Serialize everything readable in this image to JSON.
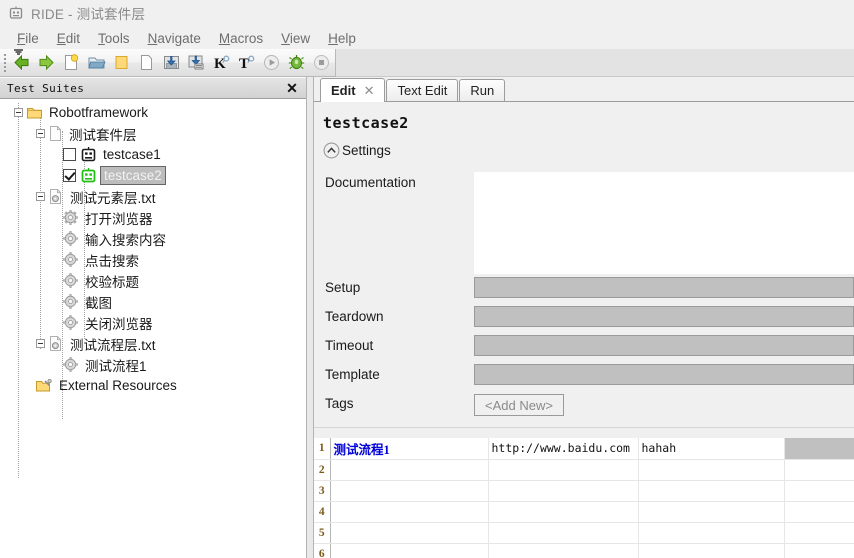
{
  "window": {
    "title": "RIDE - 测试套件层",
    "icon": "robot-icon"
  },
  "menubar": {
    "items": [
      {
        "mnemonic": "F",
        "rest": "ile"
      },
      {
        "mnemonic": "E",
        "rest": "dit"
      },
      {
        "mnemonic": "T",
        "rest": "ools"
      },
      {
        "mnemonic": "N",
        "rest": "avigate"
      },
      {
        "mnemonic": "M",
        "rest": "acros"
      },
      {
        "mnemonic": "V",
        "rest": "iew"
      },
      {
        "mnemonic": "H",
        "rest": "elp"
      }
    ]
  },
  "toolbar": {
    "buttons": [
      {
        "name": "back-arrow-icon",
        "title": "Back"
      },
      {
        "name": "forward-arrow-icon",
        "title": "Forward"
      },
      {
        "name": "new-project-icon",
        "title": "New Project"
      },
      {
        "name": "open-folder-icon",
        "title": "Open Directory"
      },
      {
        "name": "folder-icon",
        "title": "Open Folder"
      },
      {
        "name": "new-file-icon",
        "title": "New File"
      },
      {
        "name": "save-icon",
        "title": "Save"
      },
      {
        "name": "save-all-icon",
        "title": "Save All"
      },
      {
        "name": "search-keyword-icon",
        "title": "Search Keywords"
      },
      {
        "name": "search-tests-icon",
        "title": "Search Tests"
      },
      {
        "name": "run-icon",
        "title": "Run"
      },
      {
        "name": "debug-icon",
        "title": "Debug"
      },
      {
        "name": "stop-icon",
        "title": "Stop"
      }
    ]
  },
  "tree": {
    "header": "Test Suites",
    "close_label": "✕",
    "nodes": [
      {
        "label": "Robotframework",
        "icon": "folder-icon",
        "depth": 0,
        "expander": true,
        "checkbox": null,
        "selected": false
      },
      {
        "label": "测试套件层",
        "icon": "file-icon",
        "depth": 1,
        "expander": true,
        "checkbox": null,
        "selected": false
      },
      {
        "label": "testcase1",
        "icon": "robot-gray-icon",
        "depth": 2,
        "expander": false,
        "checkbox": false,
        "selected": false
      },
      {
        "label": "testcase2",
        "icon": "robot-green-icon",
        "depth": 2,
        "expander": false,
        "checkbox": true,
        "selected": true
      },
      {
        "label": "测试元素层.txt",
        "icon": "resource-file-icon",
        "depth": 1,
        "expander": true,
        "checkbox": null,
        "selected": false
      },
      {
        "label": "打开浏览器",
        "icon": "gear-icon",
        "depth": 2,
        "expander": false,
        "checkbox": null,
        "selected": false
      },
      {
        "label": "输入搜索内容",
        "icon": "gear-icon",
        "depth": 2,
        "expander": false,
        "checkbox": null,
        "selected": false
      },
      {
        "label": "点击搜索",
        "icon": "gear-icon",
        "depth": 2,
        "expander": false,
        "checkbox": null,
        "selected": false
      },
      {
        "label": "校验标题",
        "icon": "gear-icon",
        "depth": 2,
        "expander": false,
        "checkbox": null,
        "selected": false
      },
      {
        "label": "截图",
        "icon": "gear-icon",
        "depth": 2,
        "expander": false,
        "checkbox": null,
        "selected": false
      },
      {
        "label": "关闭浏览器",
        "icon": "gear-icon",
        "depth": 2,
        "expander": false,
        "checkbox": null,
        "selected": false
      },
      {
        "label": "测试流程层.txt",
        "icon": "resource-file-icon",
        "depth": 1,
        "expander": true,
        "checkbox": null,
        "selected": false
      },
      {
        "label": "测试流程1",
        "icon": "gear-icon",
        "depth": 2,
        "expander": false,
        "checkbox": null,
        "selected": false
      },
      {
        "label": "External Resources",
        "icon": "external-resources-icon",
        "depth": 0,
        "expander": false,
        "checkbox": null,
        "selected": false
      }
    ]
  },
  "editor": {
    "tabs": [
      {
        "label": "Edit",
        "active": true,
        "closable": true
      },
      {
        "label": "Text Edit",
        "active": false,
        "closable": false
      },
      {
        "label": "Run",
        "active": false,
        "closable": false
      }
    ],
    "tab_close_glyph": "✕",
    "case_title": "testcase2",
    "settings_label": "Settings",
    "settings_collapsed": false,
    "fields": [
      {
        "label": "Documentation",
        "type": "multiline",
        "value": ""
      },
      {
        "label": "Setup",
        "type": "disabled",
        "value": ""
      },
      {
        "label": "Teardown",
        "type": "disabled",
        "value": ""
      },
      {
        "label": "Timeout",
        "type": "disabled",
        "value": ""
      },
      {
        "label": "Template",
        "type": "disabled",
        "value": ""
      },
      {
        "label": "Tags",
        "type": "button",
        "value": "<Add New>"
      }
    ]
  },
  "grid": {
    "rows": [
      {
        "num": "1",
        "cells": [
          "测试流程1",
          "http://www.baidu.com",
          "hahah",
          ""
        ],
        "shaded_last": true
      },
      {
        "num": "2",
        "cells": [
          "",
          "",
          "",
          ""
        ],
        "shaded_last": false
      },
      {
        "num": "3",
        "cells": [
          "",
          "",
          "",
          ""
        ],
        "shaded_last": false
      },
      {
        "num": "4",
        "cells": [
          "",
          "",
          "",
          ""
        ],
        "shaded_last": false
      },
      {
        "num": "5",
        "cells": [
          "",
          "",
          "",
          ""
        ],
        "shaded_last": false
      },
      {
        "num": "6",
        "cells": [
          "",
          "",
          "",
          ""
        ],
        "shaded_last": false
      }
    ]
  },
  "colors": {
    "keyword_blue": "#0000d8",
    "selection_gray": "#bdbdbd",
    "disabled_field": "#c0c0c0",
    "panel_bg": "#f0f0f0",
    "robot_green": "#22c013"
  }
}
